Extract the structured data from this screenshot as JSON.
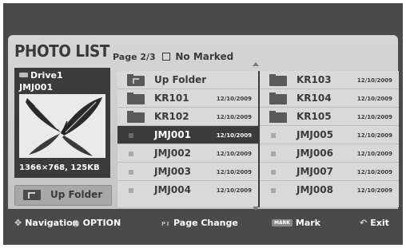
{
  "header": {
    "title": "PHOTO LIST",
    "page": "Page 2/3",
    "marked": "No Marked"
  },
  "preview": {
    "drive": "Drive1",
    "filename": "JMJ001",
    "resolution": "1366×768, 125KB",
    "thumbnail_icon": "butterfly-icon"
  },
  "up_button": {
    "label": "Up Folder",
    "icon": "up-folder-icon"
  },
  "files": {
    "col1": [
      {
        "name": "Up Folder",
        "date": "",
        "type": "up"
      },
      {
        "name": "KR101",
        "date": "12/10/2009",
        "type": "folder"
      },
      {
        "name": "KR102",
        "date": "12/10/2009",
        "type": "folder"
      },
      {
        "name": "JMJ001",
        "date": "12/10/2009",
        "type": "photo",
        "selected": true
      },
      {
        "name": "JMJ002",
        "date": "12/10/2009",
        "type": "photo"
      },
      {
        "name": "JMJ003",
        "date": "12/10/2009",
        "type": "photo"
      },
      {
        "name": "JMJ004",
        "date": "12/10/2009",
        "type": "photo"
      }
    ],
    "col2": [
      {
        "name": "KR103",
        "date": "12/10/2009",
        "type": "folder"
      },
      {
        "name": "KR104",
        "date": "12/10/2009",
        "type": "folder"
      },
      {
        "name": "KR105",
        "date": "12/10/2009",
        "type": "folder"
      },
      {
        "name": "JMJ005",
        "date": "12/10/2009",
        "type": "photo"
      },
      {
        "name": "JMJ006",
        "date": "12/10/2009",
        "type": "photo"
      },
      {
        "name": "JMJ007",
        "date": "12/10/2009",
        "type": "photo"
      },
      {
        "name": "JMJ008",
        "date": "12/10/2009",
        "type": "photo"
      }
    ]
  },
  "footer": {
    "navigation": "Navigation",
    "option": "OPTION",
    "page_change": "Page Change",
    "mark_badge": "MARK",
    "mark": "Mark",
    "exit": "Exit"
  }
}
